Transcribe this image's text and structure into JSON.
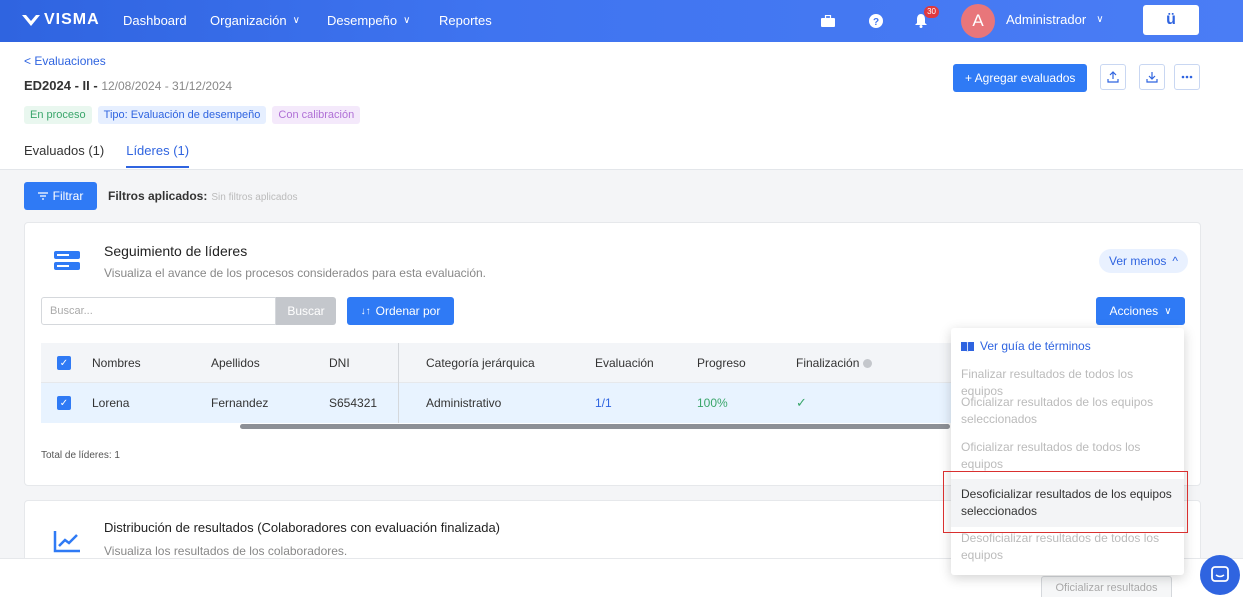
{
  "nav": {
    "logo": "VISMA",
    "items": [
      {
        "label": "Dashboard"
      },
      {
        "label": "Organización",
        "chevron": "∨"
      },
      {
        "label": "Desempeño",
        "chevron": "∨"
      },
      {
        "label": "Reportes"
      }
    ],
    "notifications_count": "30",
    "avatar_initial": "A",
    "user_name": "Administrador",
    "user_chevron": "∨",
    "app_button": "ü"
  },
  "header": {
    "back_link": "< Evaluaciones",
    "eval_code": "ED2024 - II -",
    "eval_dates": "12/08/2024 - 31/12/2024",
    "tags": [
      "En proceso",
      "Tipo: Evaluación de desempeño",
      "Con calibración"
    ],
    "tabs": [
      "Evaluados (1)",
      "Líderes (1)"
    ],
    "add_button": "+ Agregar evaluados"
  },
  "filters": {
    "filter_button": "Filtrar",
    "applied_label": "Filtros aplicados:",
    "applied_value": "Sin filtros aplicados"
  },
  "leaders_card": {
    "title": "Seguimiento de líderes",
    "subtitle": "Visualiza el avance de los procesos considerados para esta evaluación.",
    "toggle_label": "Ver menos",
    "search_placeholder": "Buscar...",
    "search_button": "Buscar",
    "sort_button": "Ordenar por",
    "actions_button": "Acciones",
    "columns": [
      "Nombres",
      "Apellidos",
      "DNI",
      "Categoría jerárquica",
      "Evaluación",
      "Progreso",
      "Finalización"
    ],
    "rows": [
      {
        "nombres": "Lorena",
        "apellidos": "Fernandez",
        "dni": "S654321",
        "categoria": "Administrativo",
        "evaluacion": "1/1",
        "progreso": "100%",
        "finalizacion": "✓"
      }
    ],
    "total": "Total de líderes: 1"
  },
  "results_card": {
    "title": "Distribución de resultados",
    "title_suffix": "(Colaboradores con evaluación finalizada)",
    "subtitle": "Visualiza los resultados de los colaboradores."
  },
  "dropdown": {
    "guide": "Ver guía de términos",
    "items": [
      "Finalizar resultados de todos los equipos",
      "Oficializar resultados de los equipos seleccionados",
      "Oficializar resultados de todos los equipos",
      "Desoficializar resultados de los equipos seleccionados",
      "Desoficializar resultados de todos los equipos"
    ]
  },
  "footer": {
    "official_button": "Oficializar resultados"
  },
  "colors": {
    "primary": "#2f7af5",
    "nav": "#3f74f0",
    "success": "#3aa66b",
    "highlight_border": "#d9302f"
  }
}
